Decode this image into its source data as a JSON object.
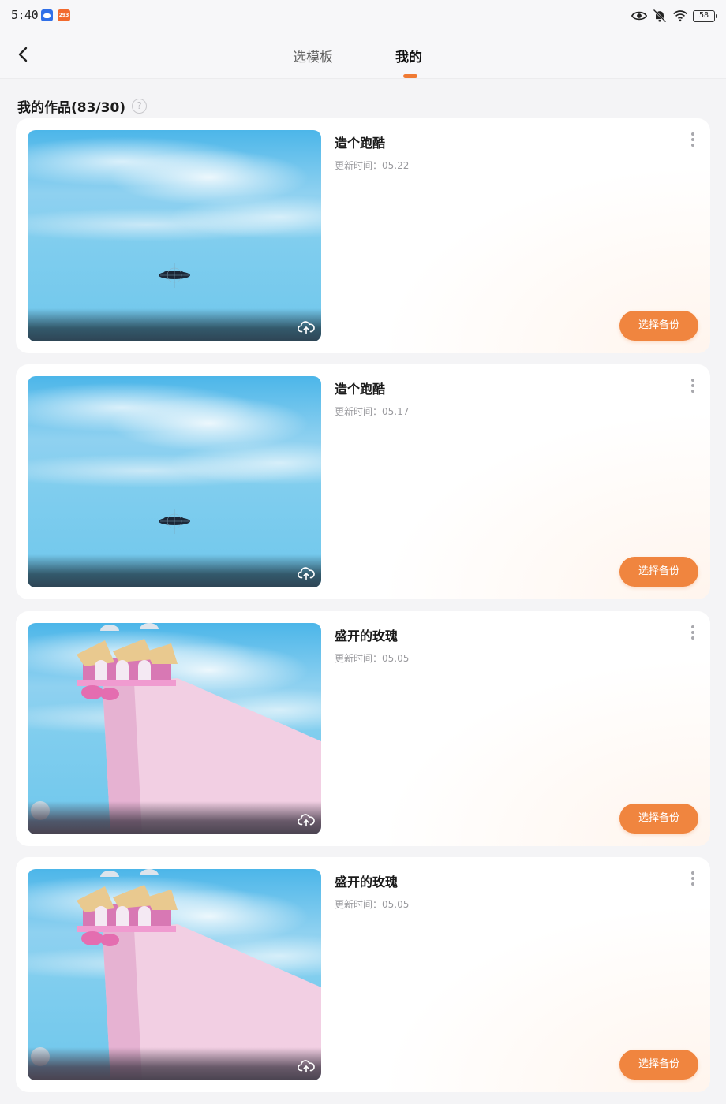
{
  "status_bar": {
    "time": "5:40",
    "notif_badge_text": "293",
    "battery": "58",
    "icons": [
      "app-notification-icon",
      "app-badge-icon",
      "eye-icon",
      "mute-bell-icon",
      "wifi-icon",
      "battery-icon"
    ]
  },
  "nav": {
    "back_icon": "chevron-left-icon",
    "tabs": [
      {
        "label": "选模板",
        "active": false
      },
      {
        "label": "我的",
        "active": true
      }
    ],
    "accent": "#f07a33"
  },
  "section": {
    "title": "我的作品(83/30)",
    "help_icon": "question-circle-icon",
    "help_glyph": "?"
  },
  "works": [
    {
      "title": "造个跑酷",
      "update_time": "更新时间：05.22",
      "action": "选择备份",
      "thumb": "sky-flying-object"
    },
    {
      "title": "造个跑酷",
      "update_time": "更新时间：05.17",
      "action": "选择备份",
      "thumb": "sky-flying-object"
    },
    {
      "title": "盛开的玫瑰",
      "update_time": "更新时间：05.05",
      "action": "选择备份",
      "thumb": "pink-castle-ramp"
    },
    {
      "title": "盛开的玫瑰",
      "update_time": "更新时间：05.05",
      "action": "选择备份",
      "thumb": "pink-castle-ramp"
    }
  ],
  "colors": {
    "button": "#f0853f",
    "page_bg": "#f4f4f6"
  }
}
